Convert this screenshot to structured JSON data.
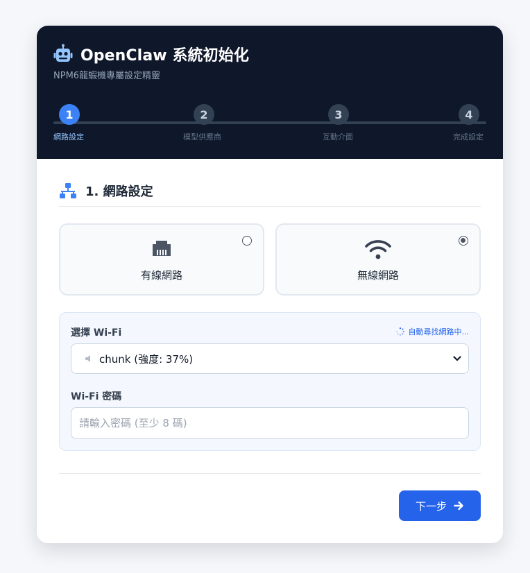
{
  "header": {
    "title": "OpenClaw 系統初始化",
    "subtitle": "NPM6龍蝦機專屬設定精靈",
    "icon": "robot-icon"
  },
  "steps": [
    {
      "number": "1",
      "label": "網路設定",
      "active": true
    },
    {
      "number": "2",
      "label": "模型供應商",
      "active": false
    },
    {
      "number": "3",
      "label": "互動介面",
      "active": false
    },
    {
      "number": "4",
      "label": "完成設定",
      "active": false
    }
  ],
  "section": {
    "title": "1. 網路設定",
    "icon": "network-icon"
  },
  "connection_options": [
    {
      "label": "有線網路",
      "icon": "ethernet-icon",
      "selected": false
    },
    {
      "label": "無線網路",
      "icon": "wifi-icon",
      "selected": true
    }
  ],
  "wifi": {
    "select_label": "選擇 Wi-Fi",
    "scan_status": "自動尋找網路中...",
    "selected_network": "chunk (強度: 37%)",
    "password_label": "Wi-Fi 密碼",
    "password_placeholder": "請輸入密碼 (至少 8 碼)"
  },
  "actions": {
    "next_label": "下一步"
  },
  "colors": {
    "header_bg": "#0f172a",
    "accent": "#3b82f6",
    "button": "#2563eb",
    "track": "#334155"
  }
}
